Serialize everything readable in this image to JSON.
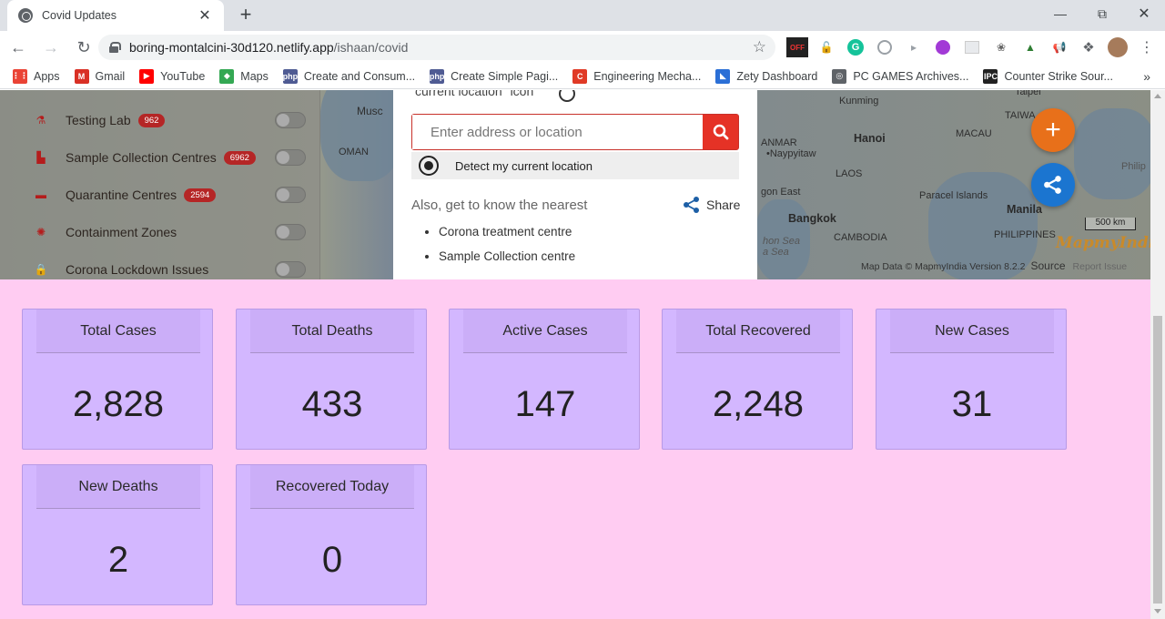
{
  "browser": {
    "tab_title": "Covid Updates",
    "url_host": "boring-montalcini-30d120.netlify.app",
    "url_path": "/ishaan/covid",
    "bookmarks": [
      {
        "label": "Apps",
        "icon": "apps-grid-icon",
        "color": "#ea4335"
      },
      {
        "label": "Gmail",
        "icon": "gmail-icon",
        "color": "#d93025"
      },
      {
        "label": "YouTube",
        "icon": "youtube-icon",
        "color": "#ff0000"
      },
      {
        "label": "Maps",
        "icon": "maps-icon",
        "color": "#34a853"
      },
      {
        "label": "Create and Consum...",
        "icon": "php-icon",
        "color": "#4f5b93"
      },
      {
        "label": "Create Simple Pagi...",
        "icon": "php-icon",
        "color": "#4f5b93"
      },
      {
        "label": "Engineering Mecha...",
        "icon": "chegg-c-icon",
        "color": "#e03a26"
      },
      {
        "label": "Zety Dashboard",
        "icon": "zety-icon",
        "color": "#2b6fd6"
      },
      {
        "label": "PC GAMES Archives...",
        "icon": "globe-icon",
        "color": "#5f6368"
      },
      {
        "label": "Counter Strike Sour...",
        "icon": "ipc-icon",
        "color": "#222222"
      }
    ],
    "more_bookmarks": "»"
  },
  "map": {
    "current_location_text": "current location\" icon",
    "search_placeholder": "Enter address or location",
    "detect_label": "Detect my current location",
    "nearest_heading": "Also, get to know the nearest",
    "share_label": "Share",
    "nearest_items": [
      "Corona treatment centre",
      "Sample Collection centre"
    ],
    "layers": [
      {
        "label": "Testing Lab",
        "badge": "962",
        "icon": "flask-icon"
      },
      {
        "label": "Sample Collection Centres",
        "badge": "6962",
        "icon": "factory-icon"
      },
      {
        "label": "Quarantine Centres",
        "badge": "2594",
        "icon": "bed-icon"
      },
      {
        "label": "Containment Zones",
        "badge": "",
        "icon": "virus-icon"
      },
      {
        "label": "Corona Lockdown Issues",
        "badge": "",
        "icon": "lock-icon"
      }
    ],
    "places": [
      "Kunming",
      "Taipei",
      "TAIWA",
      "Musc",
      "OMAN",
      "ANMAR",
      "•Naypyitaw",
      "Hanoi",
      "MACAU",
      "LAOS",
      "Paracel Islands",
      "gon East",
      "Bangkok",
      "Manila",
      "CAMBODIA",
      "PHILIPPINES",
      "hon Sea",
      "Philip",
      "a Sea"
    ],
    "scale_label": "500 km",
    "logo_text": "MapmyIndia",
    "attribution": "Map Data © MapmyIndia  Version 8.2.2",
    "source_label": "Source",
    "report_label": "Report Issue"
  },
  "stats": [
    {
      "label": "Total Cases",
      "value": "2,828"
    },
    {
      "label": "Total Deaths",
      "value": "433"
    },
    {
      "label": "Active Cases",
      "value": "147"
    },
    {
      "label": "Total Recovered",
      "value": "2,248"
    },
    {
      "label": "New Cases",
      "value": "31"
    },
    {
      "label": "New Deaths",
      "value": "2"
    },
    {
      "label": "Recovered Today",
      "value": "0"
    }
  ],
  "colors": {
    "page_bg": "#ffccf2",
    "card_bg": "#d3b7ff",
    "accent_red": "#e53226",
    "fab_orange": "#e8701a",
    "fab_blue": "#1b75d0"
  }
}
